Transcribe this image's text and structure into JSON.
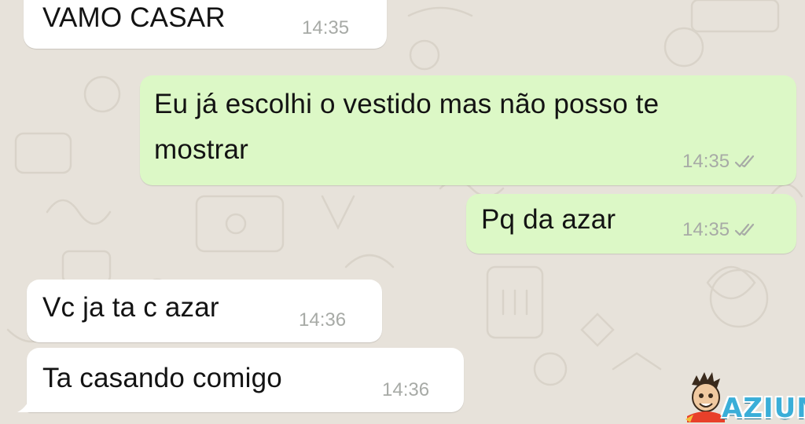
{
  "conversation": {
    "messages": [
      {
        "direction": "in",
        "text": "VAMO CASAR",
        "time": "14:35"
      },
      {
        "direction": "out",
        "text_line1": "Eu já escolhi o vestido mas não posso te",
        "text_line2": "mostrar",
        "time": "14:35",
        "status_icon": "double-check-icon"
      },
      {
        "direction": "out",
        "text": "Pq da azar",
        "time": "14:35",
        "status_icon": "double-check-icon"
      },
      {
        "direction": "in",
        "text": "Vc ja ta c azar",
        "time": "14:36"
      },
      {
        "direction": "in",
        "text": "Ta casando comigo",
        "time": "14:36"
      }
    ]
  },
  "watermark": {
    "text": "AZIUM",
    "icon": "cartoon-face-logo"
  },
  "colors": {
    "background": "#e7e2da",
    "incoming_bubble": "#ffffff",
    "outgoing_bubble": "#dcf8c6",
    "timestamp": "#a7aaa6",
    "watermark": "#3aaed8"
  }
}
